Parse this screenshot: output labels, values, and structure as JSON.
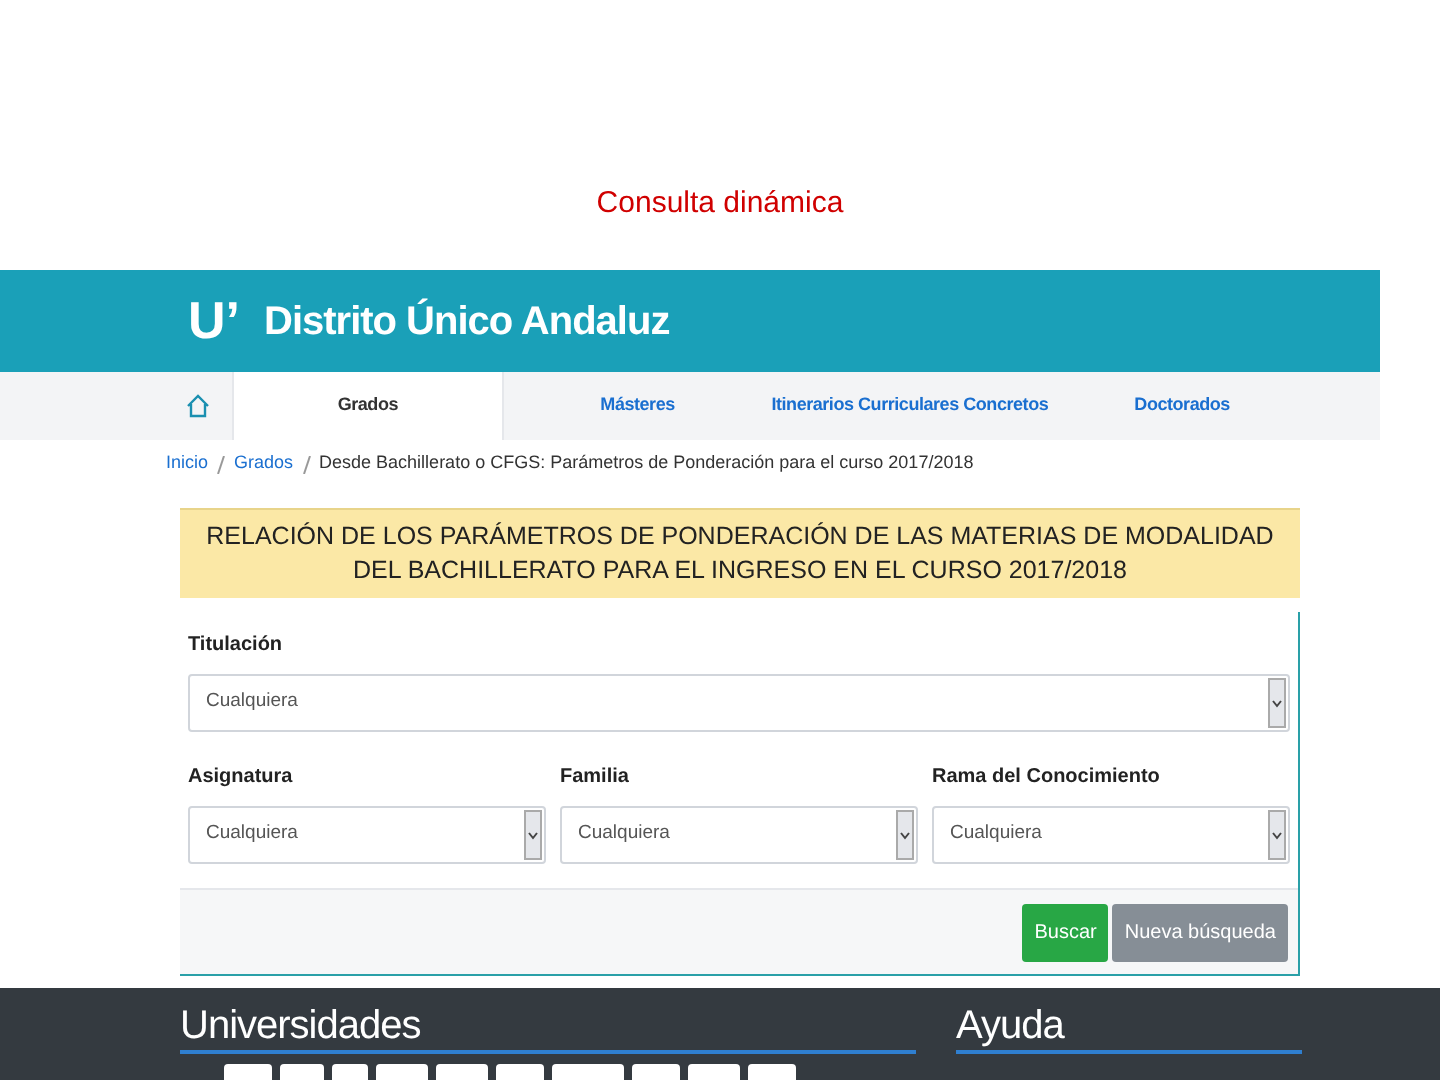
{
  "slide_title": "Consulta dinámica",
  "header": {
    "logo": "U’",
    "title": "Distrito Único Andaluz"
  },
  "tabs": [
    {
      "kind": "home",
      "selected": false
    },
    {
      "kind": "text",
      "label": "Grados",
      "selected": true
    },
    {
      "kind": "text",
      "label": "Másteres",
      "selected": false
    },
    {
      "kind": "text",
      "label": "Itinerarios Curriculares Concretos",
      "selected": false
    },
    {
      "kind": "text",
      "label": "Doctorados",
      "selected": false
    }
  ],
  "breadcrumb": [
    {
      "label": "Inicio",
      "link": true
    },
    {
      "label": "Grados",
      "link": true
    },
    {
      "label": "Desde Bachillerato o CFGS: Parámetros de Ponderación para el curso 2017/2018",
      "link": false
    }
  ],
  "banner": "RELACIÓN DE LOS PARÁMETROS DE PONDERACIÓN DE LAS MATERIAS DE MODALIDAD DEL BACHILLERATO PARA EL INGRESO EN EL CURSO 2017/2018",
  "filters": [
    {
      "label": "Titulación",
      "value": "Cualquiera"
    }
  ],
  "filters_row": [
    {
      "label": "Asignatura",
      "value": "Cualquiera"
    },
    {
      "label": "Familia",
      "value": "Cualquiera"
    },
    {
      "label": "Rama del Conocimiento",
      "value": "Cualquiera"
    }
  ],
  "buttons": [
    {
      "label": "Buscar",
      "kind": "primary"
    },
    {
      "label": "Nueva búsqueda",
      "kind": "secondary"
    }
  ],
  "footer": {
    "headings": [
      "Universidades",
      "Ayuda"
    ]
  }
}
